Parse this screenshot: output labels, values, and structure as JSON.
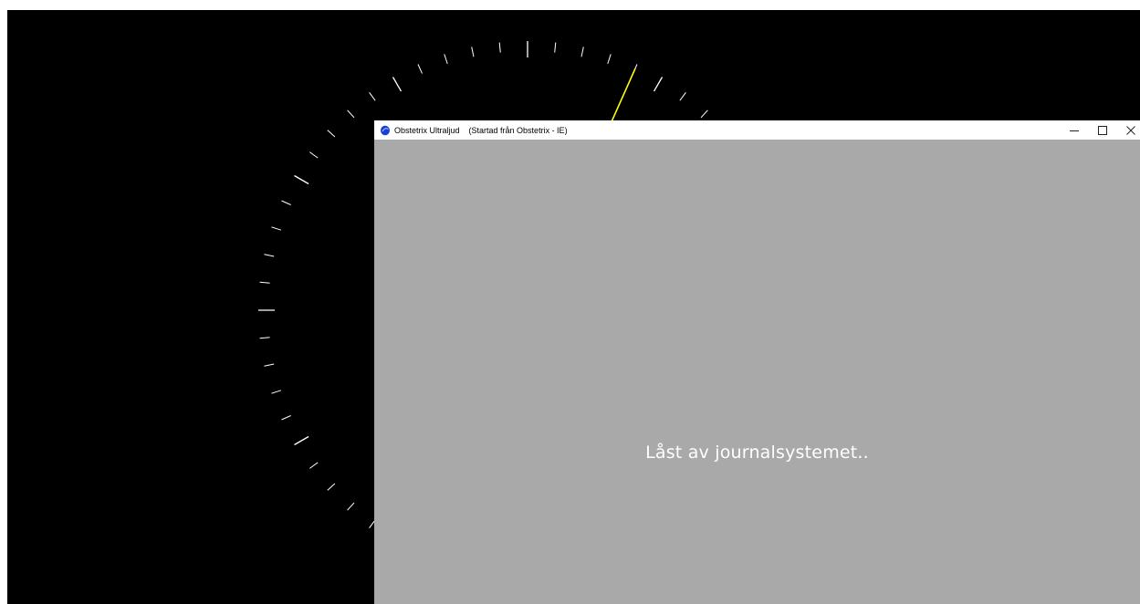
{
  "window": {
    "title": "Obstetrix Ultraljud",
    "subtitle": "(Startad från Obstetrix - IE)",
    "icon": "obstetrix-app-icon",
    "controls": {
      "minimize_icon": "minimize-icon",
      "maximize_icon": "maximize-icon",
      "close_icon": "close-icon"
    }
  },
  "main": {
    "message": "Låst av journalsystemet.."
  },
  "clock": {
    "face_color": "#000000",
    "tick_color": "#ffffff",
    "hand_color": "#ffff00",
    "second_hand_seconds": 4
  },
  "colors": {
    "client_background": "#a9a9a9",
    "title_bar": "#ffffff",
    "message_text": "#ffffff"
  }
}
